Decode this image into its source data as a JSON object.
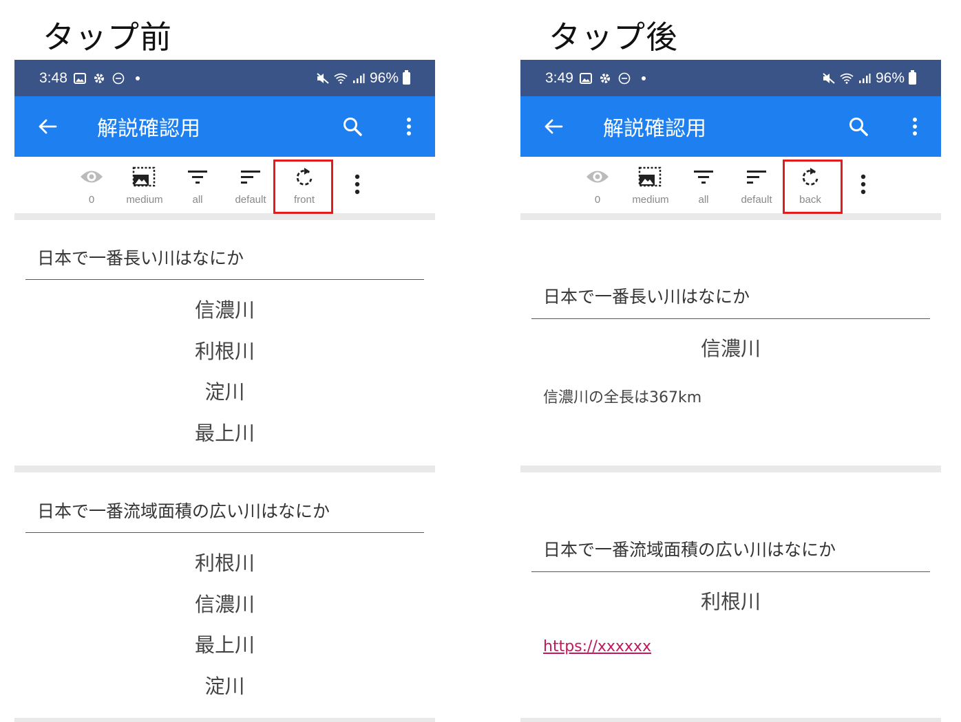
{
  "captions": {
    "before": "タップ前",
    "after": "タップ後"
  },
  "phones": [
    {
      "status": {
        "time": "3:48",
        "battery": "96%"
      },
      "appbar": {
        "title": "解説確認用"
      },
      "toolbar": {
        "eye_label": "0",
        "size_label": "medium",
        "filter_label": "all",
        "sort_label": "default",
        "flip_label": "front"
      },
      "cards": [
        {
          "question": "日本で一番長い川はなにか",
          "choices": [
            "信濃川",
            "利根川",
            "淀川",
            "最上川"
          ]
        },
        {
          "question": "日本で一番流域面積の広い川はなにか",
          "choices": [
            "利根川",
            "信濃川",
            "最上川",
            "淀川"
          ]
        }
      ]
    },
    {
      "status": {
        "time": "3:49",
        "battery": "96%"
      },
      "appbar": {
        "title": "解説確認用"
      },
      "toolbar": {
        "eye_label": "0",
        "size_label": "medium",
        "filter_label": "all",
        "sort_label": "default",
        "flip_label": "back"
      },
      "cards": [
        {
          "question": "日本で一番長い川はなにか",
          "answer": "信濃川",
          "explanation": "信濃川の全長は367km"
        },
        {
          "question": "日本で一番流域面積の広い川はなにか",
          "answer": "利根川",
          "link": "https://xxxxxx"
        }
      ]
    }
  ],
  "colors": {
    "statusbar": "#3a5487",
    "appbar": "#1e7ff0",
    "highlight": "#e11c1c",
    "link": "#c2185b"
  }
}
